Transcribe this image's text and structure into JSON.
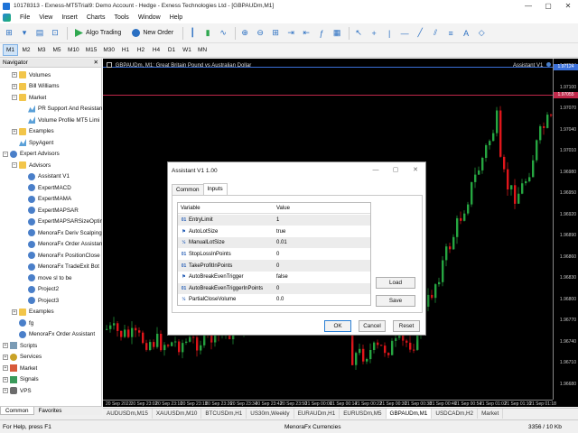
{
  "window": {
    "title": "10178313 - Exness-MT5Trial9: Demo Account - Hedge - Exness Technologies Ltd - [GBPAUDm,M1]",
    "min": "—",
    "max": "▢",
    "close": "✕"
  },
  "menu": [
    "File",
    "View",
    "Insert",
    "Charts",
    "Tools",
    "Window",
    "Help"
  ],
  "toolbar": {
    "algo_trading": "Algo Trading",
    "new_order": "New Order"
  },
  "timeframes": [
    "M1",
    "M2",
    "M3",
    "M5",
    "M10",
    "M15",
    "M30",
    "H1",
    "H2",
    "H4",
    "D1",
    "W1",
    "MN"
  ],
  "navigator": {
    "title": "Navigator",
    "close": "✕",
    "items": [
      {
        "label": "Volumes",
        "level": 2,
        "toggle": "+",
        "icon": "folder"
      },
      {
        "label": "Bill Williams",
        "level": 2,
        "toggle": "+",
        "icon": "folder"
      },
      {
        "label": "Market",
        "level": 2,
        "toggle": "−",
        "icon": "folder"
      },
      {
        "label": "PR Support And Resistan",
        "level": 3,
        "toggle": "",
        "icon": "ind"
      },
      {
        "label": "Volume Profile MT5 Limi",
        "level": 3,
        "toggle": "",
        "icon": "ind"
      },
      {
        "label": "Examples",
        "level": 2,
        "toggle": "+",
        "icon": "folder"
      },
      {
        "label": "SpyAgent",
        "level": 2,
        "toggle": "",
        "icon": "ind"
      },
      {
        "label": "Expert Advisors",
        "level": 1,
        "toggle": "−",
        "icon": "ea"
      },
      {
        "label": "Advisors",
        "level": 2,
        "toggle": "−",
        "icon": "folder"
      },
      {
        "label": "Assistant V1",
        "level": 3,
        "toggle": "",
        "icon": "ea"
      },
      {
        "label": "ExpertMACD",
        "level": 3,
        "toggle": "",
        "icon": "ea"
      },
      {
        "label": "ExpertMAMA",
        "level": 3,
        "toggle": "",
        "icon": "ea"
      },
      {
        "label": "ExpertMAPSAR",
        "level": 3,
        "toggle": "",
        "icon": "ea"
      },
      {
        "label": "ExpertMAPSARSizeOptim",
        "level": 3,
        "toggle": "",
        "icon": "ea"
      },
      {
        "label": "MenoraFx Deriv Scalping",
        "level": 3,
        "toggle": "",
        "icon": "ea"
      },
      {
        "label": "MenoraFx Order Assistan",
        "level": 3,
        "toggle": "",
        "icon": "ea"
      },
      {
        "label": "MenoraFx PositionClose",
        "level": 3,
        "toggle": "",
        "icon": "ea"
      },
      {
        "label": "MenoraFx TradeExit Bot",
        "level": 3,
        "toggle": "",
        "icon": "ea"
      },
      {
        "label": "move sl to be",
        "level": 3,
        "toggle": "",
        "icon": "ea"
      },
      {
        "label": "Project2",
        "level": 3,
        "toggle": "",
        "icon": "ea"
      },
      {
        "label": "Project3",
        "level": 3,
        "toggle": "",
        "icon": "ea"
      },
      {
        "label": "Examples",
        "level": 2,
        "toggle": "+",
        "icon": "folder"
      },
      {
        "label": "fg",
        "level": 2,
        "toggle": "",
        "icon": "ea"
      },
      {
        "label": "MenoraFx Order Assistant",
        "level": 2,
        "toggle": "",
        "icon": "ea"
      },
      {
        "label": "Scripts",
        "level": 1,
        "toggle": "+",
        "icon": "script"
      },
      {
        "label": "Services",
        "level": 1,
        "toggle": "+",
        "icon": "svc"
      },
      {
        "label": "Market",
        "level": 1,
        "toggle": "+",
        "icon": "mkt"
      },
      {
        "label": "Signals",
        "level": 1,
        "toggle": "+",
        "icon": "sig"
      },
      {
        "label": "VPS",
        "level": 1,
        "toggle": "+",
        "icon": "vps"
      }
    ],
    "tabs": [
      "Common",
      "Favorites"
    ]
  },
  "chart": {
    "title": "GBPAUDm, M1: Great Britain Pound vs Australian Dollar",
    "ea_label": "Assistant V1",
    "price_ticks": [
      "1.97134",
      "1.97100",
      "1.97070",
      "1.97040",
      "1.97010",
      "1.96980",
      "1.96950",
      "1.96920",
      "1.96890",
      "1.96860",
      "1.96830",
      "1.96800",
      "1.96770",
      "1.96740",
      "1.96710",
      "1.96680"
    ],
    "bid_badge": "1.97124",
    "ask_badge": "1.97055",
    "time_ticks": [
      "20 Sep 2022",
      "20 Sep 23:02",
      "20 Sep 23:10",
      "20 Sep 23:18",
      "20 Sep 23:26",
      "20 Sep 23:34",
      "20 Sep 23:42",
      "20 Sep 23:50",
      "21 Sep 00:06",
      "21 Sep 00:14",
      "21 Sep 00:22",
      "21 Sep 00:30",
      "21 Sep 00:38",
      "21 Sep 00:46",
      "21 Sep 00:54",
      "21 Sep 01:02",
      "21 Sep 01:10",
      "21 Sep 01:18"
    ],
    "colors": {
      "bull": "#26a641",
      "bear": "#e0161b",
      "bid_line": "#3a6fd8",
      "ask_line": "#c0284a"
    }
  },
  "chart_tabs": [
    "AUDUSDm,M15",
    "XAUUSDm,M10",
    "BTCUSDm,H1",
    "US30m,Weekly",
    "EURAUDm,H1",
    "EURUSDm,M5",
    "GBPAUDm,M1",
    "USDCADm,H2",
    "Market"
  ],
  "chart_tabs_active": 6,
  "status": {
    "help": "For Help, press F1",
    "profile": "MenoraFx Currencies",
    "traffic": "3356 / 10 Kb"
  },
  "dialog": {
    "title": "Assistant V1 1.00",
    "tabs": [
      "Common",
      "Inputs"
    ],
    "active_tab": 1,
    "headers": [
      "Variable",
      "Value"
    ],
    "rows": [
      {
        "type": "01",
        "name": "EntryLimit",
        "value": "1"
      },
      {
        "type": "⚑",
        "name": "AutoLotSize",
        "value": "true"
      },
      {
        "type": "½",
        "name": "ManualLotSize",
        "value": "0.01"
      },
      {
        "type": "01",
        "name": "StopLossInPoints",
        "value": "0"
      },
      {
        "type": "01",
        "name": "TakeProfitInPoints",
        "value": "0"
      },
      {
        "type": "⚑",
        "name": "AutoBreakEvenTrigger",
        "value": "false"
      },
      {
        "type": "01",
        "name": "AutoBreakEvenTriggerInPoints",
        "value": "0"
      },
      {
        "type": "½",
        "name": "PartialCloseVolume",
        "value": "0.0"
      }
    ],
    "buttons": {
      "load": "Load",
      "save": "Save",
      "ok": "OK",
      "cancel": "Cancel",
      "reset": "Reset"
    }
  }
}
